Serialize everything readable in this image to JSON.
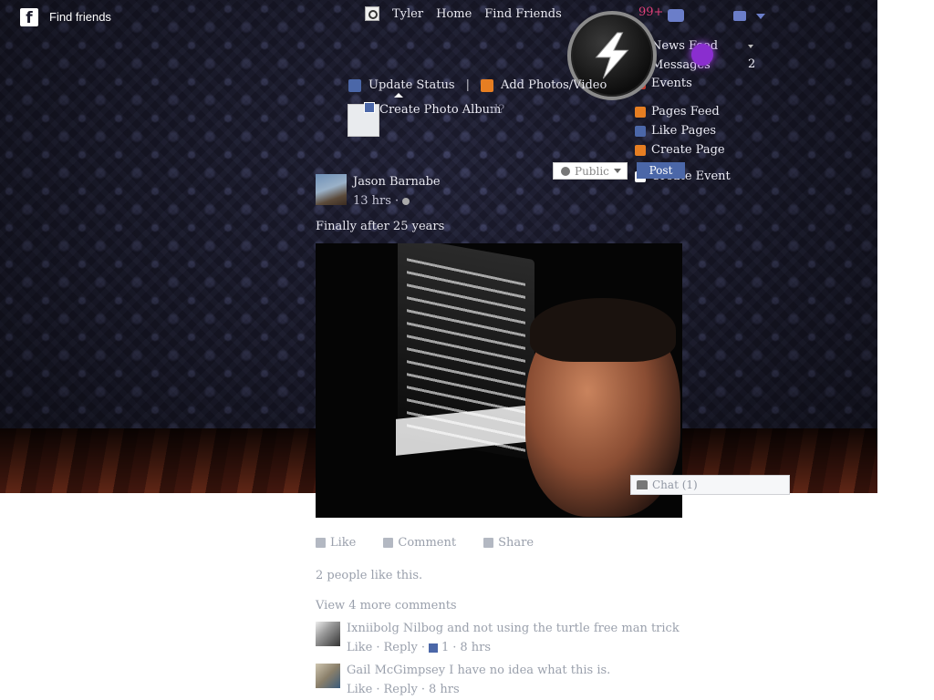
{
  "topbar": {
    "find_friends": "Find friends",
    "nav": [
      "Tyler",
      "Home",
      "Find Friends"
    ],
    "notifications": "99+"
  },
  "right_menu": {
    "items": [
      {
        "label": "News Feed",
        "icon_color": "#4b67a8"
      },
      {
        "label": "Messages",
        "icon_color": "#4b67a8"
      },
      {
        "label": "Events",
        "icon_color": "#c0392b"
      },
      {
        "label": "Pages Feed",
        "icon_color": "#e67e22"
      },
      {
        "label": "Like Pages",
        "icon_color": "#4b67a8"
      },
      {
        "label": "Create Page",
        "icon_color": "#e67e22"
      }
    ],
    "messages_count": "2",
    "event_partial": "Create Event"
  },
  "composer": {
    "update_status": "Update Status",
    "add_photos": "Add Photos/Video",
    "create_album": "Create Photo Album",
    "audience": "Public",
    "post": "Post"
  },
  "post": {
    "author": "Jason Barnabe",
    "time": "13 hrs",
    "text": "Finally after 25 years",
    "actions": {
      "like": "Like",
      "comment": "Comment",
      "share": "Share"
    },
    "likes": "2 people like this.",
    "view_more": "View 4 more comments"
  },
  "comments": [
    {
      "author": "Ixniibolg Nilbog",
      "text": "and not using the turtle free man trick",
      "like": "Like",
      "reply": "Reply",
      "likes": "1",
      "time": "8 hrs"
    },
    {
      "author": "Gail McGimpsey",
      "text": "I have no idea what this is.",
      "like": "Like",
      "reply": "Reply",
      "time": "8 hrs"
    }
  ],
  "chat": {
    "label": "Chat (1)"
  },
  "colors": {
    "accent": "#4b67a8",
    "notification": "#e0407a",
    "wallpaper": "#1b1b2d"
  }
}
